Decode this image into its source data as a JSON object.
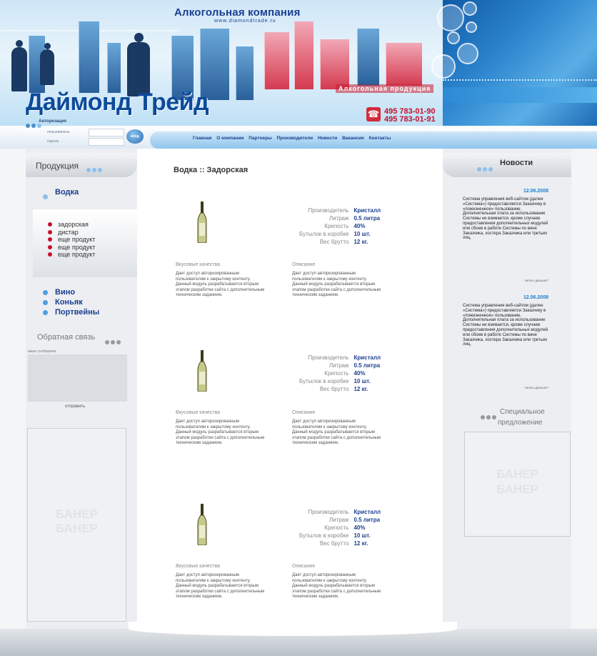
{
  "header": {
    "company": "Алкогольная компания",
    "site": "www.diamondtrade.ru",
    "title": "Даймонд Трейд",
    "product_line": "Алкогольная продукция",
    "phone_1": "495 783-01-90",
    "phone_2": "495 783-01-91",
    "phone_icon": "phone-icon"
  },
  "login": {
    "section_label": "Авторизация",
    "user_label": "пользователь",
    "pass_label": "пароль",
    "button_label": "вход"
  },
  "nav": {
    "items": [
      "Главная",
      "О компании",
      "Партнеры",
      "Производители",
      "Новости",
      "Вакансии",
      "Контакты"
    ]
  },
  "sidebar_left": {
    "products_title": "Продукция",
    "vodka_label": "Водка",
    "vodka_items": [
      "задорская",
      "дистар",
      "еще продукт",
      "еще продукт",
      "еще продукт"
    ],
    "categories": [
      "Вино",
      "Коньяк",
      "Портвейны"
    ],
    "feedback_title": "Обратная связь",
    "feedback_label": "ваше сообщение",
    "feedback_send": "отправить",
    "banner_text_1": "БАНЕР",
    "banner_text_2": "БАНЕР"
  },
  "main": {
    "breadcrumb": "Водка :: Задорская",
    "products": [
      {
        "props": [
          {
            "key": "Производитель",
            "value": "Кристалл"
          },
          {
            "key": "Литраж",
            "value": "0.5 литра"
          },
          {
            "key": "Крепость",
            "value": "40%"
          },
          {
            "key": "Бутылок в коробке",
            "value": "10 шт."
          },
          {
            "key": "Вес брутто",
            "value": "12 кг."
          }
        ],
        "taste_title": "Вкусовые качества",
        "taste_text": "Дает доступ авторизированным пользователям к закрытому контенту. Данный модуль разрабатывается вторым этапом разработки сайта с дополнительным техническим заданием.",
        "desc_title": "Описание",
        "desc_text": "Дает доступ авторизированным пользователям к закрытому контенту. Данный модуль разрабатывается вторым этапом разработки сайта с дополнительным техническим заданием."
      },
      {
        "props": [
          {
            "key": "Производитель",
            "value": "Кристалл"
          },
          {
            "key": "Литраж",
            "value": "0.5 литра"
          },
          {
            "key": "Крепость",
            "value": "40%"
          },
          {
            "key": "Бутылок в коробке",
            "value": "10 шт."
          },
          {
            "key": "Вес брутто",
            "value": "12 кг."
          }
        ],
        "taste_title": "Вкусовые качества",
        "taste_text": "Дает доступ авторизированным пользователям к закрытому контенту. Данный модуль разрабатывается вторым этапом разработки сайта с дополнительным техническим заданием.",
        "desc_title": "Описание",
        "desc_text": "Дает доступ авторизированным пользователям к закрытому контенту. Данный модуль разрабатывается вторым этапом разработки сайта с дополнительным техническим заданием."
      },
      {
        "props": [
          {
            "key": "Производитель",
            "value": "Кристалл"
          },
          {
            "key": "Литраж",
            "value": "0.5 литра"
          },
          {
            "key": "Крепость",
            "value": "40%"
          },
          {
            "key": "Бутылок в коробке",
            "value": "10 шт."
          },
          {
            "key": "Вес брутто",
            "value": "12 кг."
          }
        ],
        "taste_title": "Вкусовые качества",
        "taste_text": "Дает доступ авторизированным пользователям к закрытому контенту. Данный модуль разрабатывается вторым этапом разработки сайта с дополнительным техническим заданием.",
        "desc_title": "Описание",
        "desc_text": "Дает доступ авторизированным пользователям к закрытому контенту. Данный модуль разрабатывается вторым этапом разработки сайта с дополнительным техническим заданием."
      }
    ]
  },
  "sidebar_right": {
    "news_title": "Новости",
    "news": [
      {
        "date": "12.06.2008",
        "text": "Система управления веб-сайтом (далее «Система») предоставляется Заказчику в «пожизненное» пользование. Дополнительная плата за использование Системы не взимается, кроме случаев предоставления дополнительных модулей или сбоев в работе Системы по вине Заказчика, хостера Заказчика или третьих лиц.",
        "more": "читать дальше?"
      },
      {
        "date": "12.06.2008",
        "text": "Система управления веб-сайтом (далее «Система») предоставляется Заказчику в «пожизненное» пользование. Дополнительная плата за использование Системы не взимается, кроме случаев предоставления дополнительных модулей или сбоев в работе Системы по вине Заказчика, хостера Заказчика или третьих лиц.",
        "more": "читать дальше?"
      }
    ],
    "special_title_1": "Специальное",
    "special_title_2": "предложение",
    "banner_text_1": "БАНЕР",
    "banner_text_2": "БАНЕР"
  },
  "colors": {
    "brand_blue": "#0d4a9a",
    "link_blue": "#1b3f8f",
    "accent_red": "#c8102e",
    "news_date_blue": "#1b7fd0"
  }
}
